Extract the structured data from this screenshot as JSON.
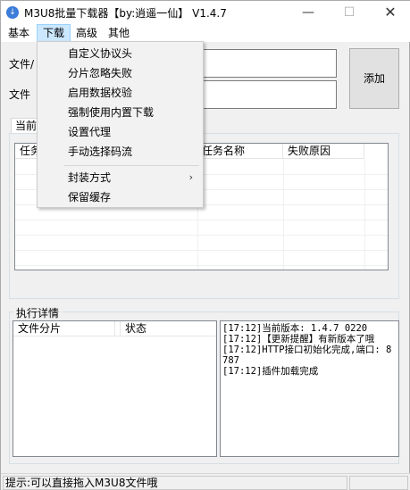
{
  "window": {
    "title": "M3U8批量下载器【by:逍遥一仙】 V1.4.7",
    "icon": "download-icon"
  },
  "menubar": {
    "items": [
      "基本",
      "下载",
      "高级",
      "其他"
    ],
    "active": "下载"
  },
  "dropdown": {
    "items": [
      {
        "label": "自定义协议头"
      },
      {
        "label": "分片忽略失败"
      },
      {
        "label": "启用数据校验"
      },
      {
        "label": "强制使用内置下载"
      },
      {
        "label": "设置代理"
      },
      {
        "label": "手动选择码流"
      },
      {
        "label": "封装方式",
        "submenu": true
      },
      {
        "label": "保留缓存"
      }
    ]
  },
  "form": {
    "file_label_1": "文件/",
    "file_label_2": "文件",
    "add_button": "添加"
  },
  "tasks": {
    "tab": "当前",
    "columns": [
      "任务",
      "任务名称",
      "失败原因"
    ]
  },
  "details": {
    "group_title": "执行详情",
    "columns": [
      "文件分片",
      "状态"
    ],
    "log": [
      "[17:12]当前版本: 1.4.7 0220",
      "[17:12]【更新提醒】有新版本了哦",
      "[17:12]HTTP接口初始化完成,端口: 8787",
      "[17:12]插件加载完成"
    ]
  },
  "statusbar": {
    "text": "提示:可以直接拖入M3U8文件哦"
  }
}
